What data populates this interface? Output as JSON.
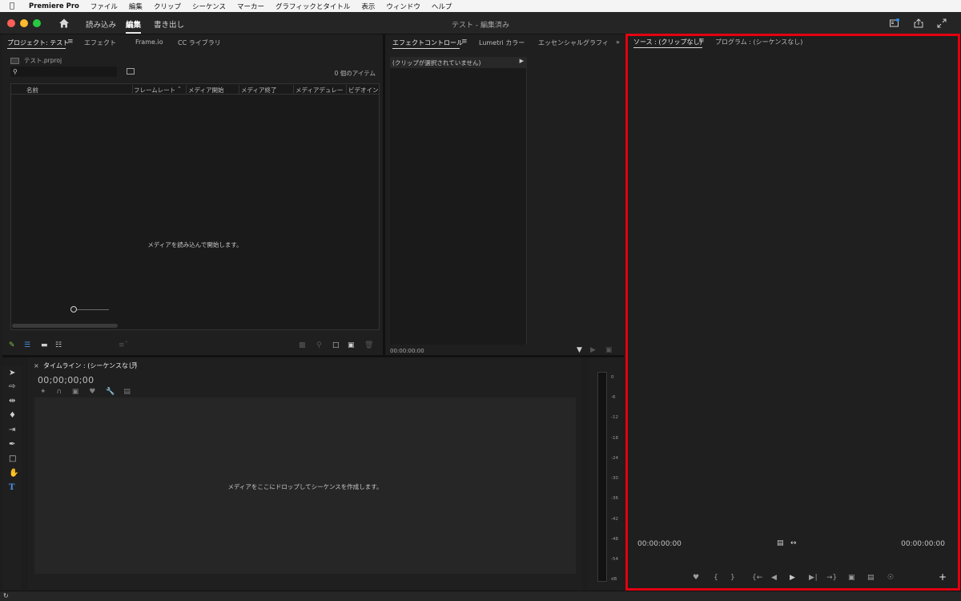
{
  "menubar": {
    "app_name": "Premiere Pro",
    "items": [
      "ファイル",
      "編集",
      "クリップ",
      "シーケンス",
      "マーカー",
      "グラフィックとタイトル",
      "表示",
      "ウィンドウ",
      "ヘルプ"
    ]
  },
  "titlebar": {
    "workspaces": [
      "読み込み",
      "編集",
      "書き出し"
    ],
    "active_workspace": "編集",
    "window_title": "テスト - 編集済み"
  },
  "project_panel": {
    "tabs": [
      "プロジェクト: テスト",
      "エフェクト",
      "Frame.io",
      "CC ライブラリ"
    ],
    "file_name": "テスト.prproj",
    "search_placeholder": "",
    "item_count": "0 個のアイテム",
    "columns": [
      "名前",
      "フレームレート",
      "メディア開始",
      "メディア終了",
      "メディアデュレー",
      "ビデオイン"
    ],
    "empty_message": "メディアを読み込んで開始します。"
  },
  "effect_controls": {
    "tabs": [
      "エフェクトコントロール",
      "Lumetri カラー",
      "エッセンシャルグラフィ"
    ],
    "header": "(クリップが選択されていません)",
    "timecode": "00:00:00:00"
  },
  "timeline": {
    "tab": "タイムライン : (シーケンスなし)",
    "close": "×",
    "timecode": "00;00;00;00",
    "empty_message": "メディアをここにドロップしてシーケンスを作成します。"
  },
  "audio_meter": {
    "labels": [
      "0",
      "-6",
      "-12",
      "-18",
      "-24",
      "-30",
      "-36",
      "-42",
      "-48",
      "-54",
      "dB"
    ]
  },
  "source_monitor": {
    "tabs": [
      "ソース : (クリップなし)",
      "プログラム : (シーケンスなし)"
    ],
    "timecode_in": "00:00:00:00",
    "timecode_out": "00:00:00:00",
    "accent": "#e3000f"
  }
}
